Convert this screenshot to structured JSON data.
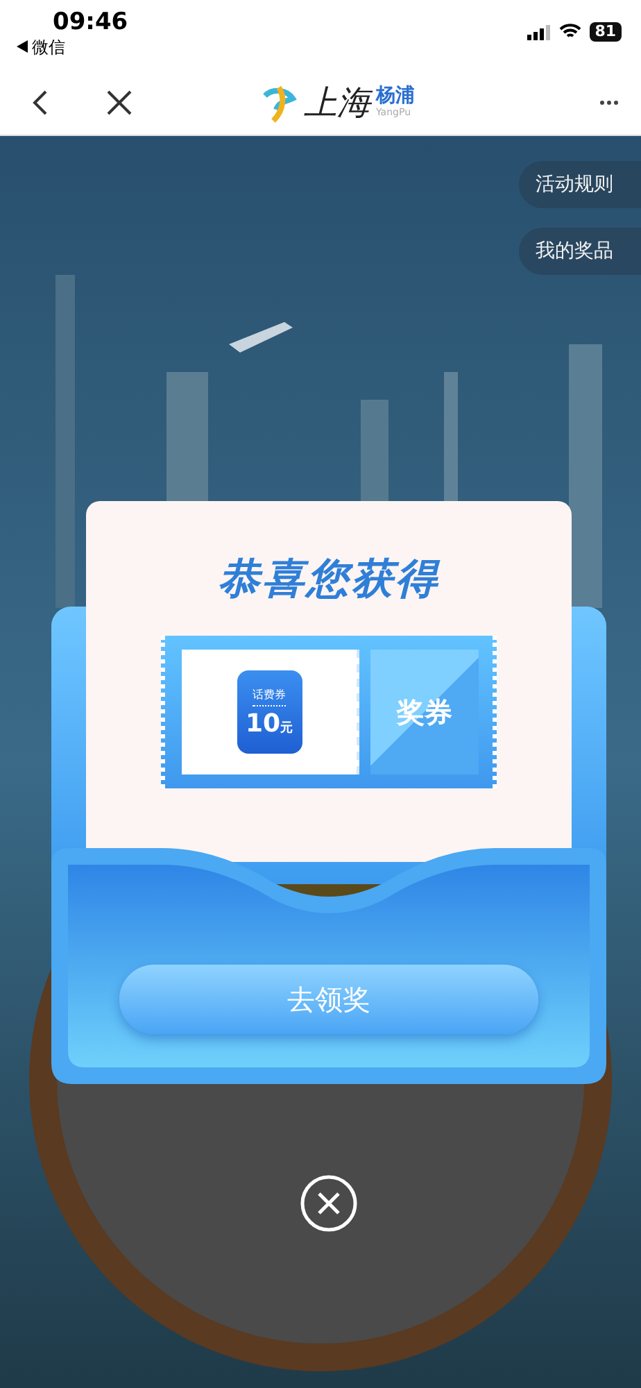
{
  "status_bar": {
    "time": "09:46",
    "back_app": "微信",
    "battery": "81"
  },
  "nav": {
    "logo_text": "上海",
    "logo_sub": "杨浦",
    "logo_latin": "YangPu"
  },
  "side_buttons": [
    "活动规则",
    "我的奖品"
  ],
  "modal": {
    "title": "恭喜您获得",
    "coupon": {
      "badge_label": "话费券",
      "amount": "10",
      "unit": "元",
      "stub": "奖券"
    },
    "button": "去领奖"
  }
}
